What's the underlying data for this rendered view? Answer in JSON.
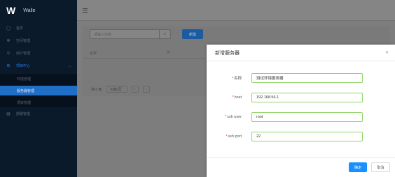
{
  "app": {
    "logo": "W",
    "name": "Walle"
  },
  "sidebar": {
    "items": [
      {
        "label": "首页",
        "icon": "home-icon"
      },
      {
        "label": "空间管理",
        "icon": "gear-icon"
      },
      {
        "label": "用户管理",
        "icon": "user-icon"
      },
      {
        "label": "项目中心",
        "icon": "settings-icon"
      }
    ],
    "sub_items": [
      {
        "label": "环境管理"
      },
      {
        "label": "服务器管理"
      },
      {
        "label": "项目管理"
      }
    ],
    "deploy": {
      "label": "部署管理",
      "icon": "deploy-icon"
    }
  },
  "main": {
    "search_placeholder": "请输入内容",
    "add_button": "新建",
    "table_headers": [
      "名称",
      "IP"
    ],
    "pager": {
      "total": "共 0 条",
      "page_size": "10条/页"
    }
  },
  "modal": {
    "title": "新增服务器",
    "fields": [
      {
        "label": "名称",
        "value": "测试环境服务器"
      },
      {
        "label": "host",
        "value": "192.168.56.1"
      },
      {
        "label": "ssh user",
        "value": "root"
      },
      {
        "label": "ssh port",
        "value": "22"
      }
    ],
    "ok_label": "确定",
    "cancel_label": "取消"
  }
}
